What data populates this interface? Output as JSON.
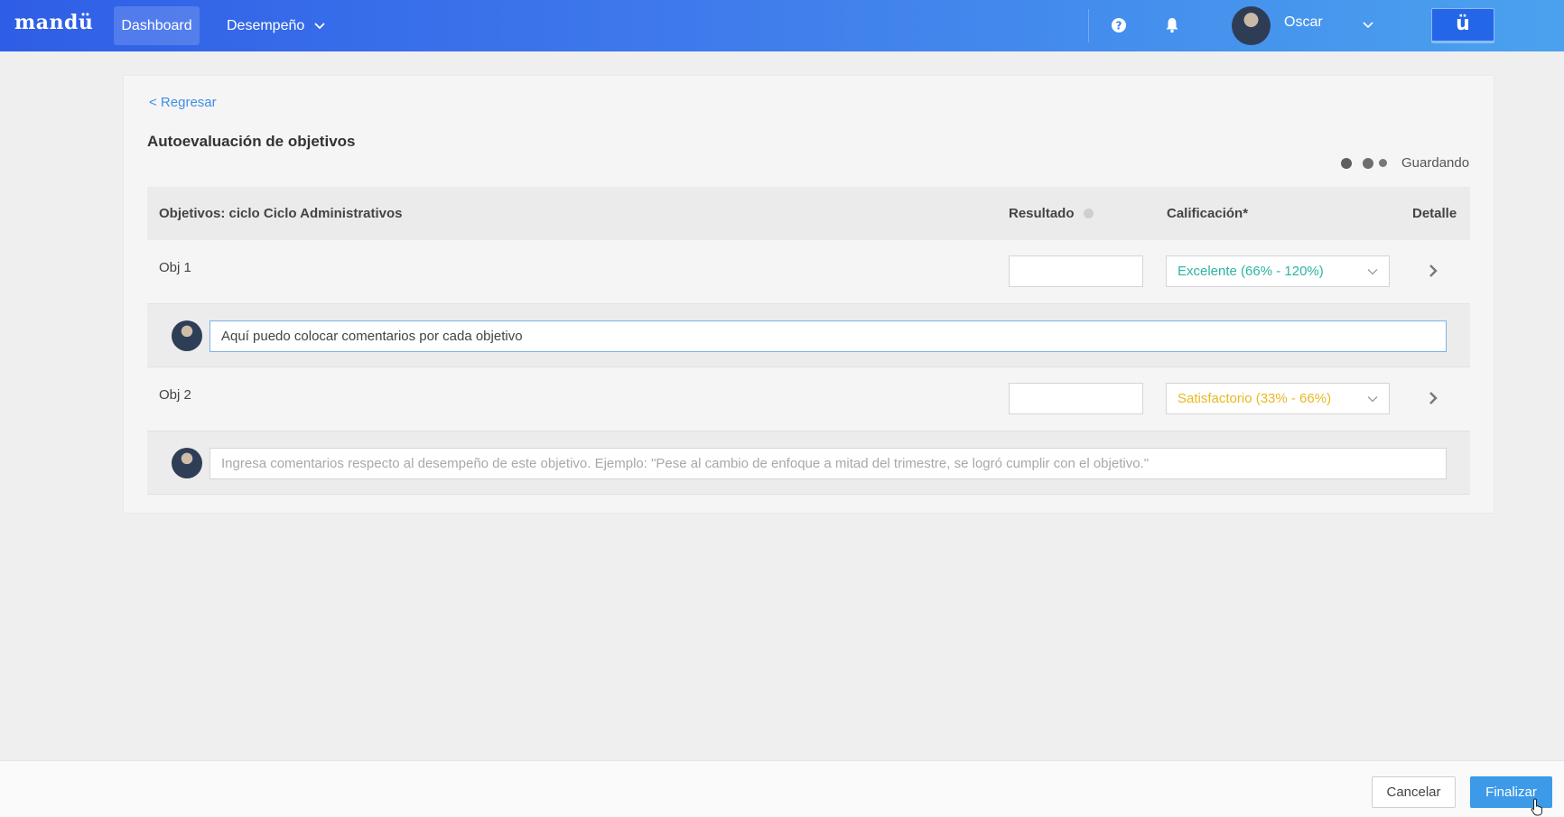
{
  "topbar": {
    "logo": "mandü",
    "nav_dashboard": "Dashboard",
    "nav_desempeno": "Desempeño",
    "user_name": "Oscar",
    "brand_button": "ü",
    "icons": [
      "help-icon",
      "bell-icon",
      "chevron-down-icon"
    ]
  },
  "page": {
    "back_link": "< Regresar",
    "title": "Autoevaluación de objetivos",
    "saving_status": "Guardando"
  },
  "table": {
    "headers": {
      "objectives": "Objetivos: ciclo Ciclo Administrativos",
      "result": "Resultado",
      "rating": "Calificación*",
      "detail": "Detalle"
    },
    "rows": [
      {
        "label": "Obj 1",
        "result_value": "",
        "rating": "Excelente (66% - 120%)",
        "rating_color": "#2bb5a0",
        "comment_value": "Aquí puedo colocar comentarios por cada objetivo",
        "comment_placeholder": ""
      },
      {
        "label": "Obj 2",
        "result_value": "",
        "rating": "Satisfactorio (33% - 66%)",
        "rating_color": "#e8b822",
        "comment_value": "",
        "comment_placeholder": "Ingresa comentarios respecto al desempeño de este objetivo. Ejemplo: \"Pese al cambio de enfoque a mitad del trimestre, se logró cumplir con el objetivo.\""
      }
    ]
  },
  "footer": {
    "cancel": "Cancelar",
    "finalize": "Finalizar"
  },
  "colors": {
    "accent": "#3d9ae8",
    "link": "#3d8fe6"
  }
}
